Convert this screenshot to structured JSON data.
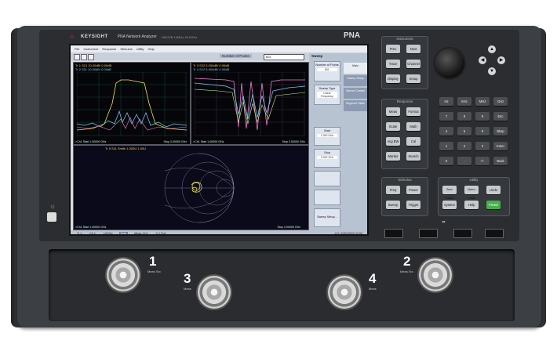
{
  "instrument": {
    "brand": "KEYSIGHT",
    "model_name": "PNA Network Analyzer",
    "model_number": "N5222B  10MHz-26.5GHz",
    "product_code": "PNA"
  },
  "screen": {
    "menu": [
      "File",
      "Instrument",
      "Response",
      "Stimulus",
      "Utility",
      "Help"
    ],
    "parameter_label": "Number of Points",
    "parameter_value": "801",
    "window1": {
      "header1": "Tr 1  S21 10.00dB/  0.00dB",
      "header2": "Tr 2  S11 10.00dB/  0.00dB",
      "foot_left": ">Ch1  Start 1.00000 GHz",
      "foot_right": "Stop 3.00000 GHz"
    },
    "window2": {
      "header1": "Tr 3  S22 5.000dB/  0.00dB",
      "header2": "Tr 4  S12 5.000dB/  0.00dB",
      "foot_left": ">Ch1  Start 1.00000 GHz",
      "foot_right": "Stop 3.00000 GHz"
    },
    "window3": {
      "header1": "Tr 5  S11 Smith 1.000U  1.00U",
      "foot_left": ">Ch1  Start 1.00000 GHz",
      "foot_right": "Stop 3.00000 GHz"
    },
    "softkey_title": "Sweep",
    "softkeys": [
      {
        "label": "Number of Points",
        "value": "801"
      },
      {
        "label": "Sweep Type",
        "value": "Linear Frequency"
      },
      {
        "label": "Start",
        "value": "1.000 GHz"
      },
      {
        "label": "Stop",
        "value": "3.000 GHz"
      },
      {
        "label": "Sweep Setup...",
        "value": ""
      }
    ],
    "side_tabs": [
      "Main",
      "Sweep Setup",
      "Source Control",
      "Segment Table"
    ],
    "statusbar": [
      "Tr 1",
      "Ch 1",
      "LCl/Src",
      "Hold",
      "Meas: Ch1",
      "C  1 Port"
    ],
    "statusbar_right": "LCL  01/01/2019 12:00"
  },
  "keypad": {
    "instrument_group": {
      "title": "Instrument",
      "keys": [
        "Prev",
        "Next",
        "Trace",
        "Channel",
        "Display",
        "Setup"
      ]
    },
    "response_group": {
      "title": "Response",
      "keys": [
        "Meas",
        "Format",
        "Scale",
        "Math",
        "Avg BW",
        "Cal",
        "Marker",
        "Search"
      ]
    },
    "numeric": {
      "keys": [
        "Hz",
        "kHz",
        "MHz",
        "GHz",
        "7",
        "8",
        "9",
        "Esc",
        "4",
        "5",
        "6",
        "Bksp",
        "1",
        "2",
        "3",
        "Enter",
        "0",
        ".",
        "+/-",
        "Back"
      ]
    },
    "stimulus_group": {
      "title": "Stimulus",
      "keys": [
        "Freq",
        "Power",
        "Sweep",
        "Trigger"
      ]
    },
    "utility_group": {
      "title": "Utility",
      "keys": [
        "Save Recall",
        "Macro Local",
        "Undo",
        "System",
        "Help",
        "Preset"
      ]
    }
  },
  "ports": [
    {
      "number": "1",
      "sub": "Meas  Src"
    },
    {
      "number": "3",
      "sub": "Meas"
    },
    {
      "number": "4",
      "sub": "Meas"
    },
    {
      "number": "2",
      "sub": "Meas  Src"
    }
  ],
  "colors": {
    "trace_s21": "#f2e14c",
    "trace_s11": "#7fd0ff",
    "trace_s22": "#f27ad0",
    "trace_s12": "#c8f27a",
    "preset_key": "#46b04a",
    "brand_logo": "#dd2233"
  }
}
